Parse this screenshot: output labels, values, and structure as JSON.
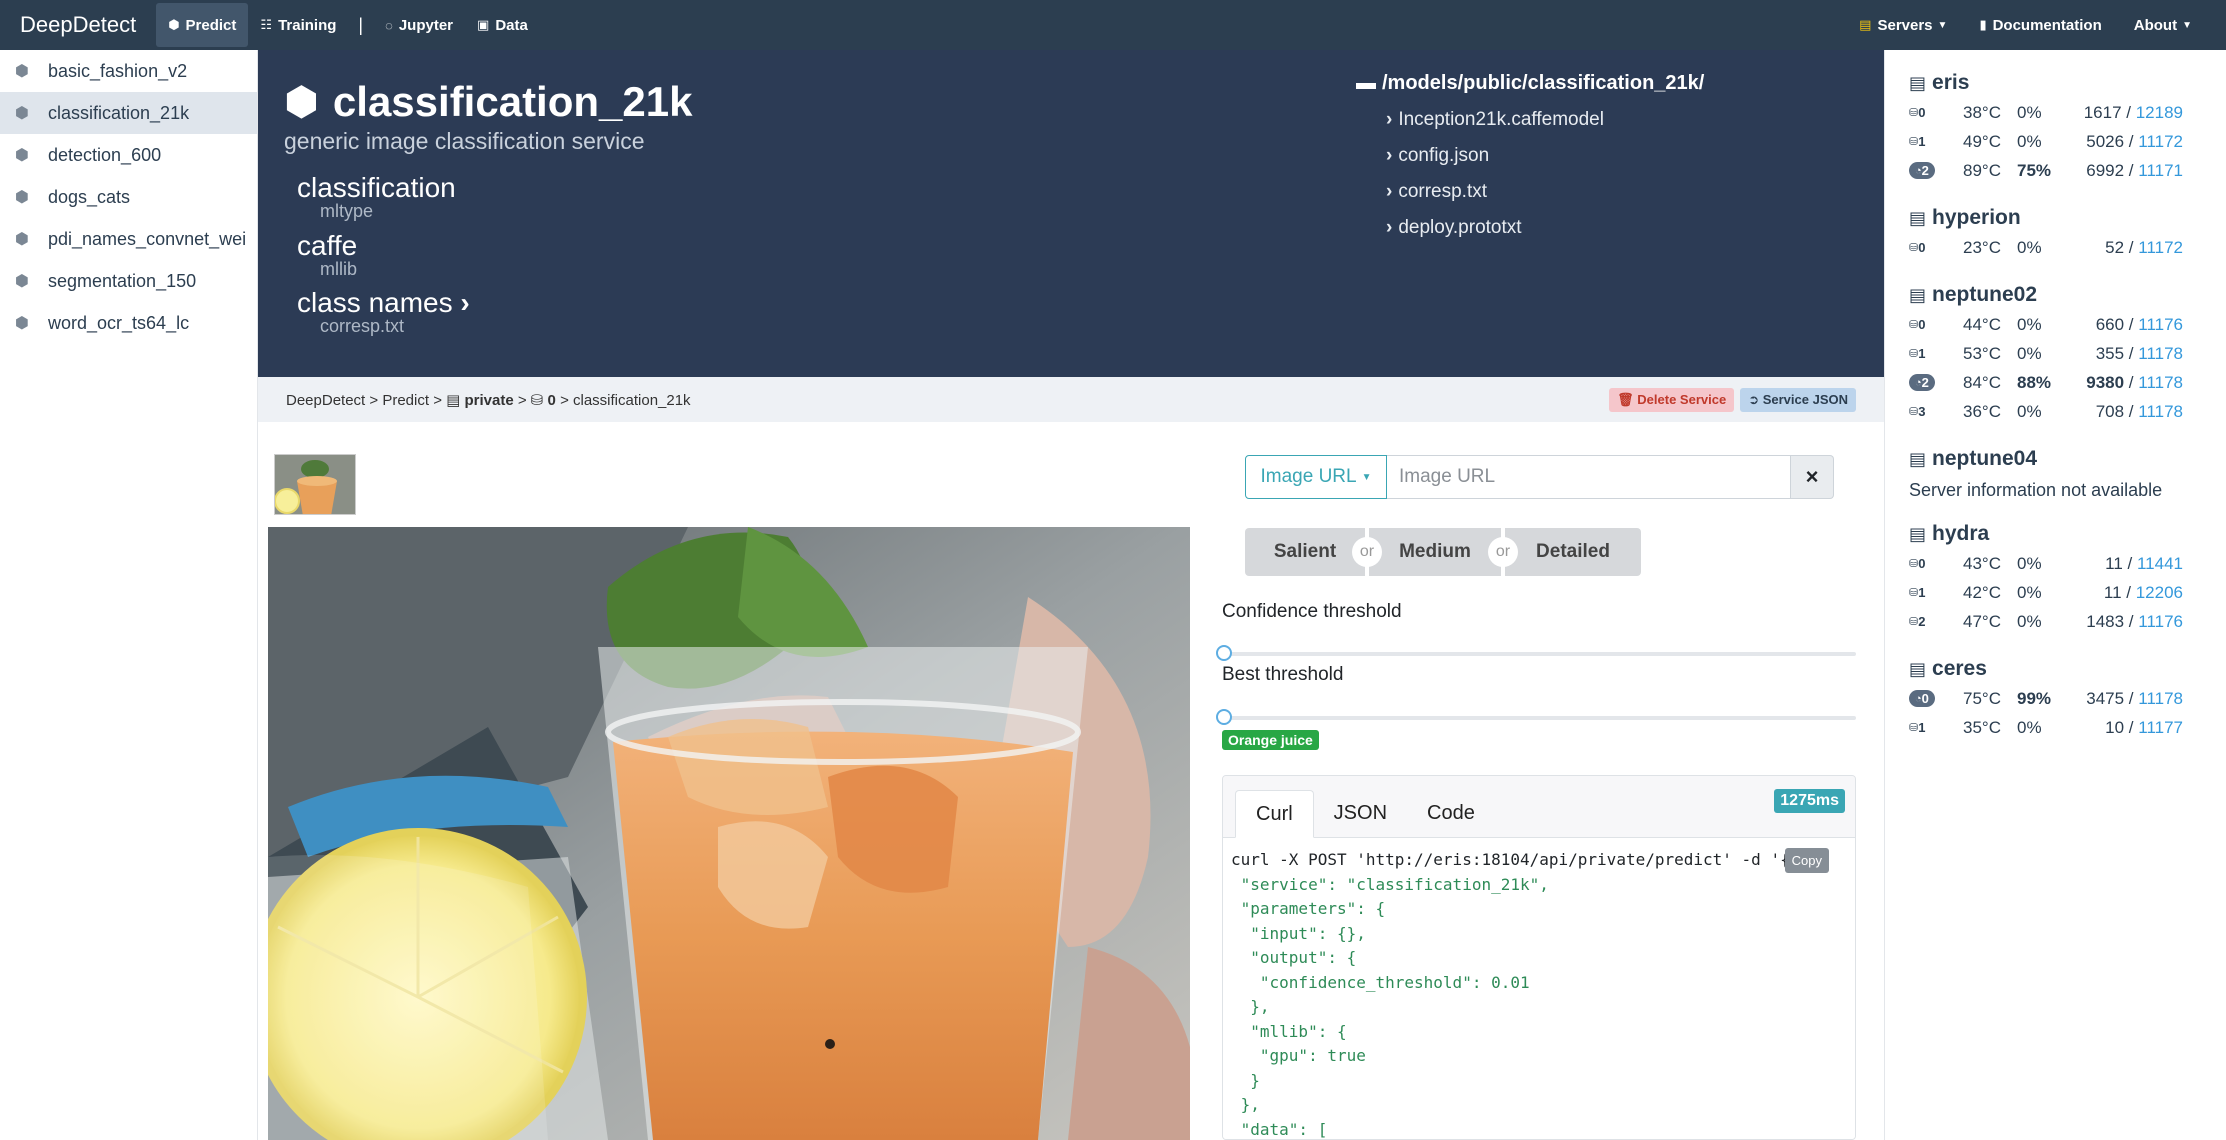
{
  "navbar": {
    "brand": "DeepDetect",
    "items": [
      {
        "label": "Predict",
        "icon": "cube-icon",
        "active": true
      },
      {
        "label": "Training",
        "icon": "grid-icon",
        "active": false
      },
      {
        "label": "Jupyter",
        "icon": "circle-notch-icon",
        "active": false
      },
      {
        "label": "Data",
        "icon": "save-icon",
        "active": false
      }
    ],
    "right": [
      {
        "label": "Servers",
        "icon": "servers-icon"
      },
      {
        "label": "Documentation",
        "icon": "book-icon"
      },
      {
        "label": "About"
      }
    ]
  },
  "sidebar": {
    "items": [
      {
        "label": "basic_fashion_v2",
        "active": false
      },
      {
        "label": "classification_21k",
        "active": true
      },
      {
        "label": "detection_600",
        "active": false
      },
      {
        "label": "dogs_cats",
        "active": false
      },
      {
        "label": "pdi_names_convnet_wei",
        "active": false
      },
      {
        "label": "segmentation_150",
        "active": false
      },
      {
        "label": "word_ocr_ts64_lc",
        "active": false
      }
    ]
  },
  "service": {
    "title": "classification_21k",
    "subtitle": "generic image classification service",
    "props": [
      {
        "value": "classification",
        "key": "mltype"
      },
      {
        "value": "caffe",
        "key": "mllib"
      },
      {
        "value": "class names",
        "key": "corresp.txt"
      }
    ],
    "repo": {
      "path": "/models/public/classification_21k/",
      "files": [
        "Inception21k.caffemodel",
        "config.json",
        "corresp.txt",
        "deploy.prototxt"
      ]
    }
  },
  "breadcrumb": {
    "root": "DeepDetect",
    "predict": "Predict",
    "server": "private",
    "gpu": "0",
    "service": "classification_21k",
    "sep": ">"
  },
  "actions": {
    "delete": "Delete Service",
    "json": "Service JSON"
  },
  "input": {
    "type_label": "Image URL",
    "placeholder": "Image URL",
    "clear": "×"
  },
  "modes": [
    "Salient",
    "Medium",
    "Detailed"
  ],
  "mode_or": "or",
  "confidence_label": "Confidence threshold",
  "confidence_value": 0.0,
  "best_label": "Best threshold",
  "best_value": 0.0,
  "result_tag": "Orange juice",
  "code": {
    "tabs": [
      "Curl",
      "JSON",
      "Code"
    ],
    "active_tab": "Curl",
    "time": "1275ms",
    "copy": "Copy",
    "lines": [
      "curl -X POST 'http://eris:18104/api/private/predict' -d '{",
      " \"service\": \"classification_21k\",",
      " \"parameters\": {",
      "  \"input\": {},",
      "  \"output\": {",
      "   \"confidence_threshold\": 0.01",
      "  },",
      "  \"mllib\": {",
      "   \"gpu\": true",
      "  }",
      " },",
      " \"data\": ["
    ]
  },
  "servers": [
    {
      "name": "eris",
      "gpus": [
        {
          "id": "0",
          "temp": "38°C",
          "util": "0%",
          "used": "1617",
          "total": "12189",
          "busy": false
        },
        {
          "id": "1",
          "temp": "49°C",
          "util": "0%",
          "used": "5026",
          "total": "11172",
          "busy": false
        },
        {
          "id": "2",
          "temp": "89°C",
          "util": "75%",
          "used": "6992",
          "total": "11171",
          "busy": true
        }
      ]
    },
    {
      "name": "hyperion",
      "gpus": [
        {
          "id": "0",
          "temp": "23°C",
          "util": "0%",
          "used": "52",
          "total": "11172",
          "busy": false
        }
      ]
    },
    {
      "name": "neptune02",
      "gpus": [
        {
          "id": "0",
          "temp": "44°C",
          "util": "0%",
          "used": "660",
          "total": "11176",
          "busy": false
        },
        {
          "id": "1",
          "temp": "53°C",
          "util": "0%",
          "used": "355",
          "total": "11178",
          "busy": false
        },
        {
          "id": "2",
          "temp": "84°C",
          "util": "88%",
          "used": "9380",
          "total": "11178",
          "busy": true
        },
        {
          "id": "3",
          "temp": "36°C",
          "util": "0%",
          "used": "708",
          "total": "11178",
          "busy": false
        }
      ]
    },
    {
      "name": "neptune04",
      "unavailable": "Server information not available",
      "gpus": []
    },
    {
      "name": "hydra",
      "gpus": [
        {
          "id": "0",
          "temp": "43°C",
          "util": "0%",
          "used": "11",
          "total": "11441",
          "busy": false
        },
        {
          "id": "1",
          "temp": "42°C",
          "util": "0%",
          "used": "11",
          "total": "12206",
          "busy": false
        },
        {
          "id": "2",
          "temp": "47°C",
          "util": "0%",
          "used": "1483",
          "total": "11176",
          "busy": false
        }
      ]
    },
    {
      "name": "ceres",
      "gpus": [
        {
          "id": "0",
          "temp": "75°C",
          "util": "99%",
          "used": "3475",
          "total": "11178",
          "busy": true
        },
        {
          "id": "1",
          "temp": "35°C",
          "util": "0%",
          "used": "10",
          "total": "11177",
          "busy": false
        }
      ]
    }
  ],
  "colors": {
    "navbar": "#2c3e50",
    "hero": "#2c3b55",
    "accent": "#3aa6b4",
    "tag": "#28a745",
    "link": "#3498db"
  }
}
